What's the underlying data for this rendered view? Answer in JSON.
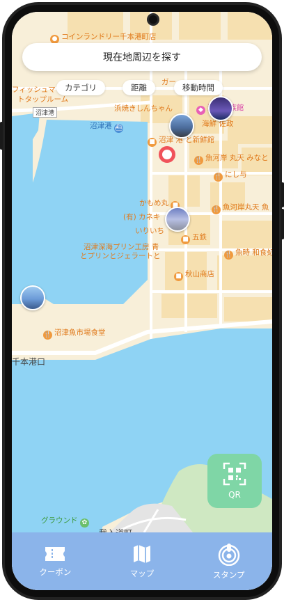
{
  "search_button_label": "現在地周辺を探す",
  "filters": [
    {
      "label": "カテゴリ"
    },
    {
      "label": "距離"
    },
    {
      "label": "移動時間"
    }
  ],
  "map_labels": {
    "coin_laundry": "コインランドリー千本港町店",
    "fish_room_1": "フィッシュマ",
    "fish_room_2": "トタップルーム",
    "numazu_port_station": "沼津港",
    "numazu_port": "沼津港",
    "hamayaki": "浜焼きしんちゃん",
    "aquarium": "深海水族館",
    "sazaemon": "海鮮 佐政",
    "shinsenkan": "沼津 港 と新鮮館",
    "uogashi_marumata": "魚河岸 丸天 みなと",
    "nishiyo": "にし与",
    "kamomemaru": "かもめ丸",
    "uogashi_marumata2": "魚河岸丸天 魚",
    "kaneki": "(有) カネキ",
    "irii": "いりいち",
    "gotetsu": "五鉄",
    "uoichi": "魚時 和食処",
    "pudding1": "沼津深海プリン工房 青",
    "pudding2": "とプリンとジェラートと",
    "akiyama": "秋山商店",
    "market_cafeteria": "沼津魚市場食堂",
    "senbon_minato": "千本港口",
    "ground": "グラウンド",
    "gaman_cho": "我入道町",
    "garage": "ガー"
  },
  "qr_button": {
    "label": "QR",
    "icon": "qr-scan-icon"
  },
  "bottom_nav": [
    {
      "label": "クーポン",
      "icon": "ticket-icon"
    },
    {
      "label": "マップ",
      "icon": "map-icon"
    },
    {
      "label": "スタンプ",
      "icon": "stamp-icon"
    }
  ],
  "colors": {
    "water": "#8fd3f4",
    "land": "#faf1dc",
    "block": "#f7e3b8",
    "accent_pin": "#f0525a",
    "qr_bg": "#7fd6a6",
    "bottom_bar": "#8bb4ea"
  }
}
